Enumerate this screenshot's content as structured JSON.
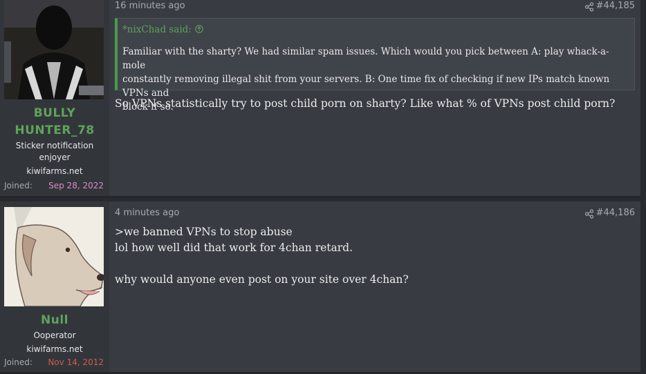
{
  "posts": [
    {
      "author": "BULLY HUNTER_78",
      "user_title": "Sticker notification enjoyer",
      "site": "kiwifarms.net",
      "joined_label": "Joined:",
      "joined_date": "Sep 28, 2022",
      "time": "16 minutes ago",
      "post_number": "#44,185",
      "quote": {
        "author_line": "*nixChad said:",
        "text": "Familiar with the sharty? We had similar spam issues. Which would you pick between A: play whack-a-mole\nconstantly removing illegal shit from your servers. B: One time fix of checking if new IPs match known VPNs and\nblock if so."
      },
      "body": "So VPNs statistically try to post child porn on sharty? Like what % of VPNs post child porn?"
    },
    {
      "author": "Null",
      "user_title": "Ooperator",
      "site": "kiwifarms.net",
      "joined_label": "Joined:",
      "joined_date": "Nov 14, 2012",
      "time": "4 minutes ago",
      "post_number": "#44,186",
      "body": ">we banned VPNs to stop abuse\nlol how well did that work for 4chan retard.\n\nwhy would anyone even post on your site over 4chan?"
    }
  ],
  "colors": {
    "username": "#5fa35a",
    "joined_date_1": "#d98ac4",
    "joined_date_2": "#d05a4f",
    "quote_border": "#4c9a4f"
  },
  "icons": [
    "share-icon",
    "arrow-up-circle-icon"
  ]
}
